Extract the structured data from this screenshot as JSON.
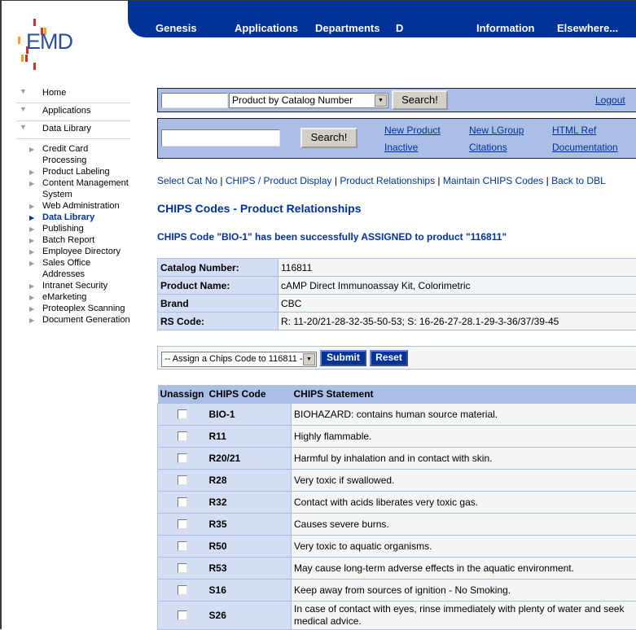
{
  "logo": {
    "text": "EMD"
  },
  "topnav": [
    "Genesis",
    "Applications",
    "Departments",
    "D",
    "Information",
    "Elsewhere..."
  ],
  "sidebar": {
    "main": [
      {
        "label": "Home",
        "icon": "triangle-down-icon"
      },
      {
        "label": "Applications",
        "icon": "triangle-down-icon"
      },
      {
        "label": "Data Library",
        "icon": "triangle-down-icon"
      }
    ],
    "sub": [
      {
        "label": "Credit Card Processing"
      },
      {
        "label": "Product Labeling"
      },
      {
        "label": "Content Management System"
      },
      {
        "label": "Web Administration"
      },
      {
        "label": "Data Library",
        "active": true
      },
      {
        "label": "Publishing"
      },
      {
        "label": "Batch Report"
      },
      {
        "label": "Employee Directory"
      },
      {
        "label": "Sales Office Addresses"
      },
      {
        "label": "Intranet Security"
      },
      {
        "label": "eMarketing"
      },
      {
        "label": "Proteoplex Scanning"
      },
      {
        "label": "Document Generation"
      }
    ]
  },
  "search1": {
    "value": "",
    "select": "Product by Catalog Number",
    "button": "Search!",
    "logout": "Logout"
  },
  "search2": {
    "value": "",
    "button": "Search!",
    "links": [
      "New Product",
      "New LGroup",
      "HTML Ref",
      "Inactive",
      "Citations",
      "Documentation"
    ]
  },
  "breadcrumbs": [
    "Select Cat No",
    "CHIPS / Product Display",
    "Product Relationships",
    "Maintain CHIPS Codes",
    "Back to DBL"
  ],
  "page_title": "CHIPS Codes - Product Relationships",
  "message": "CHIPS Code \"BIO-1\" has been successfully ASSIGNED to product \"116811\"",
  "product_info": [
    {
      "label": "Catalog Number:",
      "value": "116811"
    },
    {
      "label": "Product Name:",
      "value": "cAMP Direct Immunoassay Kit, Colorimetric"
    },
    {
      "label": "Brand",
      "value": "CBC"
    },
    {
      "label": "RS Code:",
      "value": "R: 11-20/21-28-32-35-50-53; S: 16-26-27-28.1-29-3-36/37/39-45"
    }
  ],
  "assign": {
    "select": "-- Assign a Chips Code to 116811 --",
    "submit": "Submit",
    "reset": "Reset"
  },
  "chips_table": {
    "headers": [
      "Unassign",
      "CHIPS Code",
      "CHIPS Statement"
    ],
    "rows": [
      {
        "code": "BIO-1",
        "statement": "BIOHAZARD: contains human source material.",
        "checked": false
      },
      {
        "code": "R11",
        "statement": "Highly flammable.",
        "checked": false
      },
      {
        "code": "R20/21",
        "statement": "Harmful by inhalation and in contact with skin.",
        "checked": false
      },
      {
        "code": "R28",
        "statement": "Very toxic if swallowed.",
        "checked": false
      },
      {
        "code": "R32",
        "statement": "Contact with acids liberates very toxic gas.",
        "checked": false
      },
      {
        "code": "R35",
        "statement": "Causes severe burns.",
        "checked": false
      },
      {
        "code": "R50",
        "statement": "Very toxic to aquatic organisms.",
        "checked": false
      },
      {
        "code": "R53",
        "statement": "May cause long-term adverse effects in the aquatic environment.",
        "checked": false
      },
      {
        "code": "S16",
        "statement": "Keep away from sources of ignition - No Smoking.",
        "checked": false
      },
      {
        "code": "S26",
        "statement": "In case of contact with eyes, rinse immediately with plenty of water and seek medical advice.",
        "checked": false
      }
    ]
  }
}
